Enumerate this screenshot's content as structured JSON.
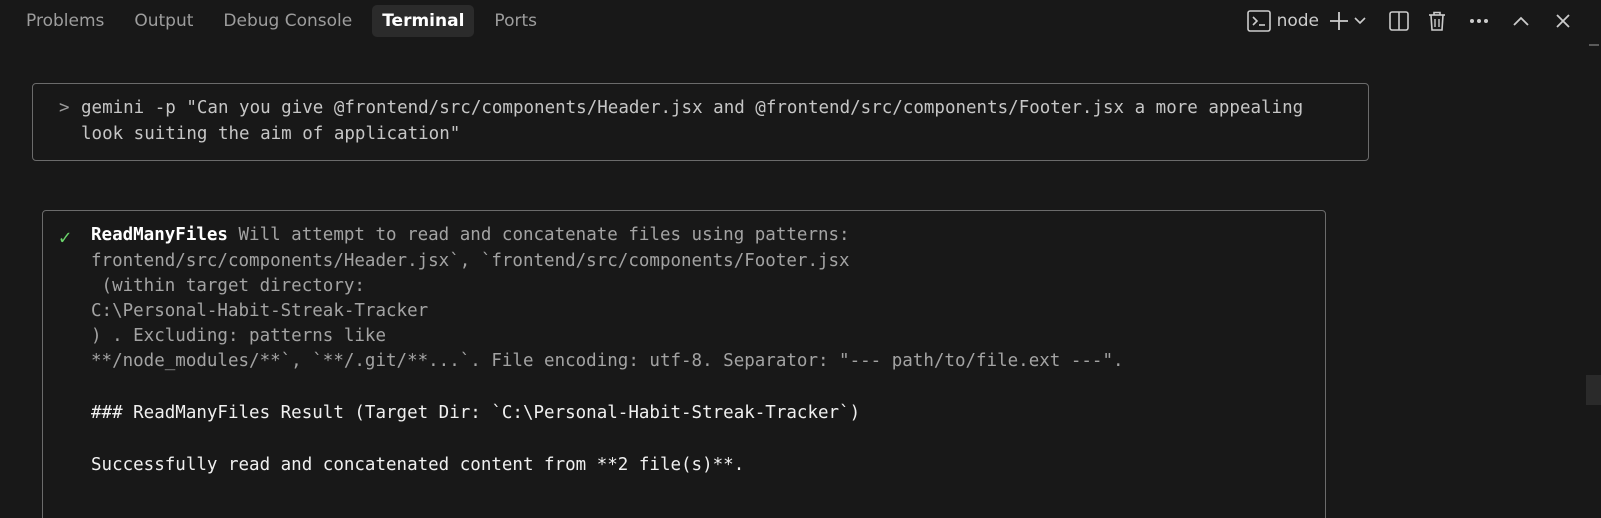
{
  "tabs": [
    {
      "label": "Problems",
      "active": false
    },
    {
      "label": "Output",
      "active": false
    },
    {
      "label": "Debug Console",
      "active": false
    },
    {
      "label": "Terminal",
      "active": true
    },
    {
      "label": "Ports",
      "active": false
    }
  ],
  "toolbar": {
    "terminal_name": "node",
    "icons": [
      "terminal-icon",
      "plus-icon",
      "chevron-down-icon",
      "split-icon",
      "trash-icon",
      "more-icon",
      "chevron-up-icon",
      "close-icon"
    ]
  },
  "command": {
    "prompt": ">",
    "line1": "gemini -p \"Can you give @frontend/src/components/Header.jsx and @frontend/src/components/Footer.jsx a more appealing",
    "line2": "look suiting the aim of application\""
  },
  "tool": {
    "status_icon": "check-icon",
    "status_glyph": "✓",
    "name": "ReadManyFiles",
    "first_line": " Will attempt to read and concatenate files using patterns:",
    "lines": [
      "frontend/src/components/Header.jsx`, `frontend/src/components/Footer.jsx",
      " (within target directory:",
      "C:\\Personal-Habit-Streak-Tracker",
      ") . Excluding: patterns like",
      "**/node_modules/**`, `**/.git/**...`. File encoding: utf-8. Separator: \"--- path/to/file.ext ---\"."
    ],
    "result_heading": "### ReadManyFiles Result (Target Dir: `C:\\Personal-Habit-Streak-Tracker`)",
    "result_text": "Successfully read and concatenated content from **2 file(s)**."
  },
  "colors": {
    "background": "#181818",
    "active_tab_bg": "#2b2b2b",
    "border": "#6b6b6b",
    "success": "#6bd46b"
  }
}
